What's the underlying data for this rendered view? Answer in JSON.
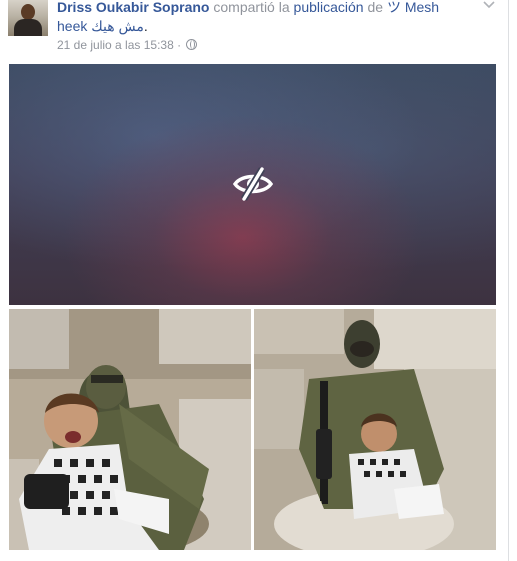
{
  "post": {
    "author": "Driss Oukabir Soprano",
    "action": "compartió la",
    "object": "publicación",
    "preposition": "de",
    "page_name_prefix": "ツ Mesh",
    "page_name_line2": "heek",
    "page_name_arabic": "مش هيك",
    "period": ".",
    "timestamp": "21 de julio a las 15:38",
    "separator": "·"
  },
  "icons": {
    "options": "chevron-down-icon",
    "privacy": "globe-icon",
    "hidden_media": "eye-slash-icon"
  },
  "colors": {
    "link": "#365899",
    "muted": "#90949c",
    "text": "#1d2129"
  }
}
